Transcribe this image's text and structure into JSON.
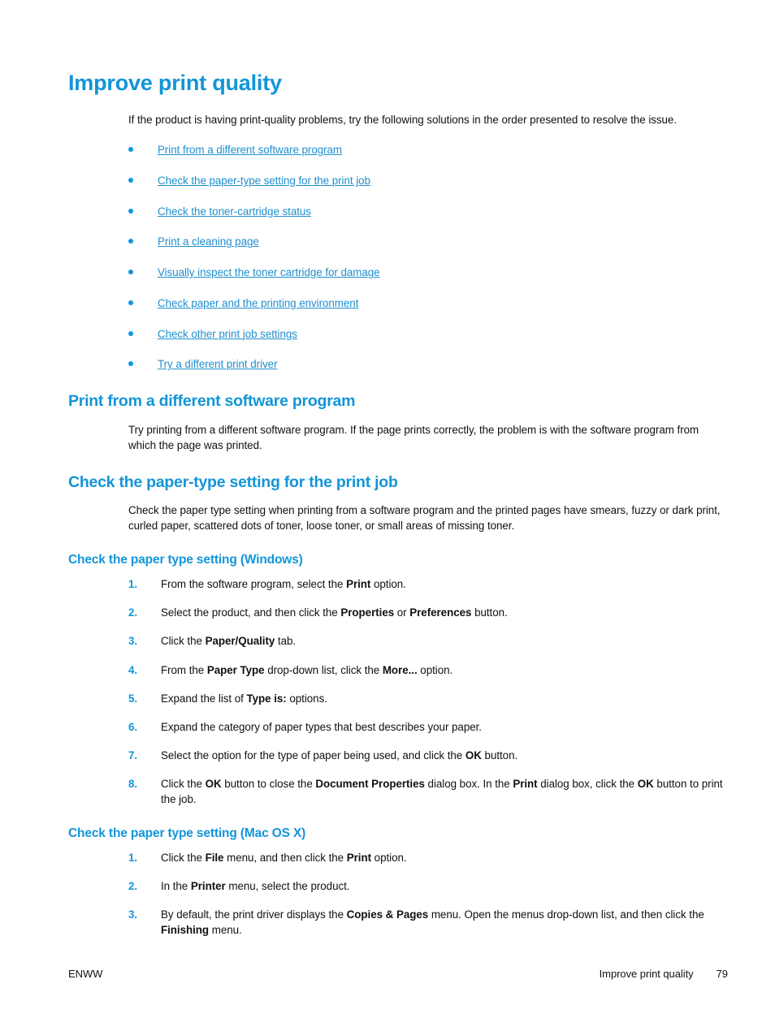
{
  "page": {
    "title": "Improve print quality",
    "intro": "If the product is having print-quality problems, try the following solutions in the order presented to resolve the issue."
  },
  "link_list": [
    {
      "label": "Print from a different software program"
    },
    {
      "label": "Check the paper-type setting for the print job"
    },
    {
      "label": "Check the toner-cartridge status"
    },
    {
      "label": "Print a cleaning page"
    },
    {
      "label": "Visually inspect the toner cartridge for damage"
    },
    {
      "label": "Check paper and the printing environment"
    },
    {
      "label": "Check other print job settings"
    },
    {
      "label": "Try a different print driver"
    }
  ],
  "sections": {
    "software_program": {
      "heading": "Print from a different software program",
      "para": "Try printing from a different software program. If the page prints correctly, the problem is with the software program from which the page was printed."
    },
    "paper_type": {
      "heading": "Check the paper-type setting for the print job",
      "para": "Check the paper type setting when printing from a software program and the printed pages have smears, fuzzy or dark print, curled paper, scattered dots of toner, loose toner, or small areas of missing toner."
    },
    "windows": {
      "heading": "Check the paper type setting (Windows)",
      "steps": [
        {
          "num": "1.",
          "parts": [
            {
              "t": "From the software program, select the "
            },
            {
              "t": "Print",
              "b": true
            },
            {
              "t": " option."
            }
          ]
        },
        {
          "num": "2.",
          "parts": [
            {
              "t": "Select the product, and then click the "
            },
            {
              "t": "Properties",
              "b": true
            },
            {
              "t": " or "
            },
            {
              "t": "Preferences",
              "b": true
            },
            {
              "t": " button."
            }
          ]
        },
        {
          "num": "3.",
          "parts": [
            {
              "t": "Click the "
            },
            {
              "t": "Paper/Quality",
              "b": true
            },
            {
              "t": " tab."
            }
          ]
        },
        {
          "num": "4.",
          "parts": [
            {
              "t": "From the "
            },
            {
              "t": "Paper Type",
              "b": true
            },
            {
              "t": " drop-down list, click the "
            },
            {
              "t": "More...",
              "b": true
            },
            {
              "t": " option."
            }
          ]
        },
        {
          "num": "5.",
          "parts": [
            {
              "t": "Expand the list of "
            },
            {
              "t": "Type is:",
              "b": true
            },
            {
              "t": " options."
            }
          ]
        },
        {
          "num": "6.",
          "parts": [
            {
              "t": "Expand the category of paper types that best describes your paper."
            }
          ]
        },
        {
          "num": "7.",
          "parts": [
            {
              "t": "Select the option for the type of paper being used, and click the "
            },
            {
              "t": "OK",
              "b": true
            },
            {
              "t": " button."
            }
          ]
        },
        {
          "num": "8.",
          "parts": [
            {
              "t": "Click the "
            },
            {
              "t": "OK",
              "b": true
            },
            {
              "t": " button to close the "
            },
            {
              "t": "Document Properties",
              "b": true
            },
            {
              "t": " dialog box. In the "
            },
            {
              "t": "Print",
              "b": true
            },
            {
              "t": " dialog box, click the "
            },
            {
              "t": "OK",
              "b": true
            },
            {
              "t": " button to print the job."
            }
          ]
        }
      ]
    },
    "mac": {
      "heading": "Check the paper type setting (Mac OS X)",
      "steps": [
        {
          "num": "1.",
          "parts": [
            {
              "t": "Click the "
            },
            {
              "t": "File",
              "b": true
            },
            {
              "t": " menu, and then click the "
            },
            {
              "t": "Print",
              "b": true
            },
            {
              "t": " option."
            }
          ]
        },
        {
          "num": "2.",
          "parts": [
            {
              "t": "In the "
            },
            {
              "t": "Printer",
              "b": true
            },
            {
              "t": " menu, select the product."
            }
          ]
        },
        {
          "num": "3.",
          "parts": [
            {
              "t": "By default, the print driver displays the "
            },
            {
              "t": "Copies & Pages",
              "b": true
            },
            {
              "t": " menu. Open the menus drop-down list, and then click the "
            },
            {
              "t": "Finishing",
              "b": true
            },
            {
              "t": " menu."
            }
          ]
        }
      ]
    }
  },
  "footer": {
    "left": "ENWW",
    "title": "Improve print quality",
    "page_number": "79"
  },
  "colors": {
    "accent_blue": "#1295D8",
    "link_blue": "#1F8FCF",
    "text_black": "#111111"
  }
}
